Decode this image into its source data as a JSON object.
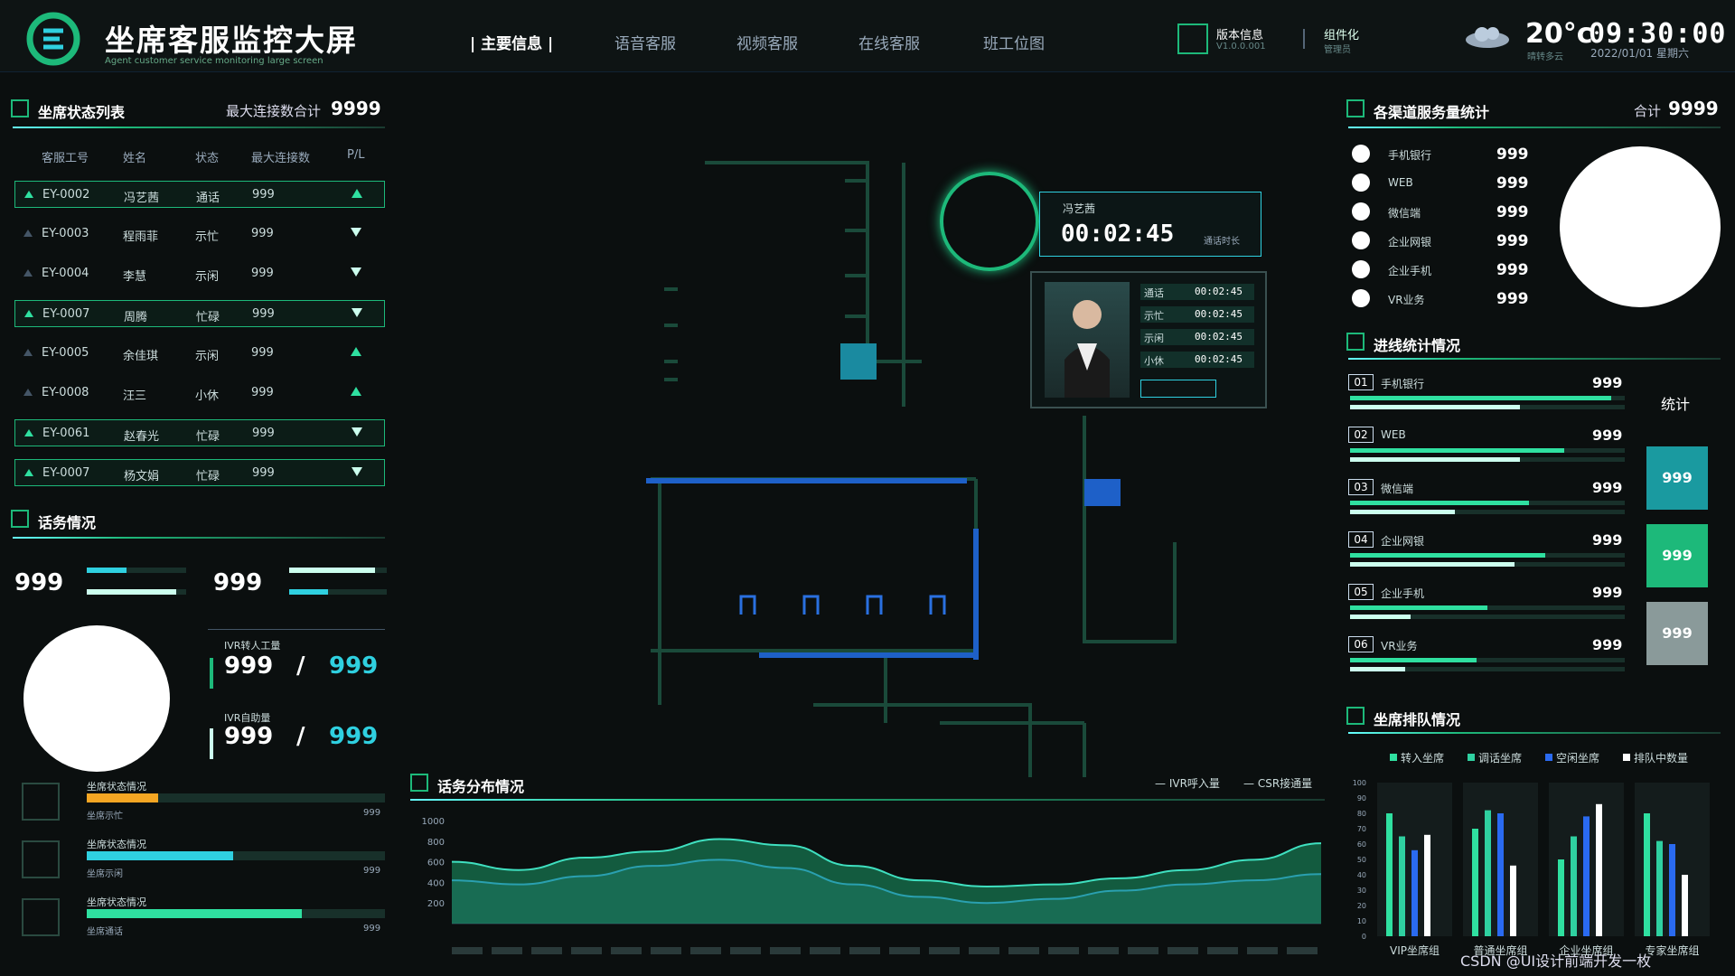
{
  "header": {
    "title": "坐席客服监控大屏",
    "subtitle": "Agent customer service monitoring large screen",
    "nav": [
      "| 主要信息 |",
      "语音客服",
      "视频客服",
      "在线客服",
      "班工位图"
    ],
    "version_label": "版本信息",
    "version_sub": "V1.0.0.001",
    "org_label": "组件化",
    "org_sub": "管理员",
    "temperature": "20°c",
    "time": "09:30:00",
    "date": "2022/01/01 星期六",
    "weather": "晴转多云"
  },
  "agent_status": {
    "title": "坐席状态列表",
    "max_conn_label": "最大连接数合计",
    "max_conn_value": "9999",
    "columns": [
      "客服工号",
      "姓名",
      "状态",
      "最大连接数",
      "P/L"
    ],
    "rows": [
      {
        "id": "EY-0002",
        "name": "冯艺茜",
        "status": "通话",
        "max": "999",
        "dir": "up",
        "hl": true
      },
      {
        "id": "EY-0003",
        "name": "程雨菲",
        "status": "示忙",
        "max": "999",
        "dir": "down",
        "hl": false
      },
      {
        "id": "EY-0004",
        "name": "李慧",
        "status": "示闲",
        "max": "999",
        "dir": "down",
        "hl": false
      },
      {
        "id": "EY-0007",
        "name": "周腾",
        "status": "忙碌",
        "max": "999",
        "dir": "down",
        "hl": true
      },
      {
        "id": "EY-0005",
        "name": "余佳琪",
        "status": "示闲",
        "max": "999",
        "dir": "up",
        "hl": false
      },
      {
        "id": "EY-0008",
        "name": "汪三",
        "status": "小休",
        "max": "999",
        "dir": "up",
        "hl": false
      },
      {
        "id": "EY-0061",
        "name": "赵春光",
        "status": "忙碌",
        "max": "999",
        "dir": "down",
        "hl": true
      },
      {
        "id": "EY-0007",
        "name": "杨文娟",
        "status": "忙碌",
        "max": "999",
        "dir": "down",
        "hl": true
      }
    ]
  },
  "call_info": {
    "title": "话务情况",
    "left_value": "999",
    "right_value": "999",
    "ivr_transfer_label": "IVR转人工量",
    "ivr_transfer_a": "999",
    "ivr_transfer_b": "999",
    "ivr_self_label": "IVR自助量",
    "ivr_self_a": "999",
    "ivr_self_b": "999",
    "status_items": [
      {
        "title": "坐席状态情况",
        "sub": "坐席示忙",
        "value": "999",
        "fill": 0.24,
        "color": "#f5a623"
      },
      {
        "title": "坐席状态情况",
        "sub": "坐席示闲",
        "value": "999",
        "fill": 0.49,
        "color": "#2fd0e0"
      },
      {
        "title": "坐席状态情况",
        "sub": "坐席通话",
        "value": "999",
        "fill": 0.72,
        "color": "#2fe0a0"
      }
    ]
  },
  "call_card": {
    "name": "冯艺茜",
    "duration": "00:02:45",
    "duration_label": "通话时长",
    "rows": [
      {
        "label": "通话",
        "value": "00:02:45"
      },
      {
        "label": "示忙",
        "value": "00:02:45"
      },
      {
        "label": "示闲",
        "value": "00:02:45"
      },
      {
        "label": "小休",
        "value": "00:02:45"
      }
    ]
  },
  "channel_stats": {
    "title": "各渠道服务量统计",
    "total_label": "合计",
    "total_value": "9999",
    "items": [
      {
        "label": "手机银行",
        "value": "999"
      },
      {
        "label": "WEB",
        "value": "999"
      },
      {
        "label": "微信端",
        "value": "999"
      },
      {
        "label": "企业网银",
        "value": "999"
      },
      {
        "label": "企业手机",
        "value": "999"
      },
      {
        "label": "VR业务",
        "value": "999"
      }
    ]
  },
  "incoming": {
    "title": "进线统计情况",
    "stat_label": "统计",
    "items": [
      {
        "no": "01",
        "label": "手机银行",
        "value": "999",
        "a": 0.95,
        "b": 0.62
      },
      {
        "no": "02",
        "label": "WEB",
        "value": "999",
        "a": 0.78,
        "b": 0.62
      },
      {
        "no": "03",
        "label": "微信端",
        "value": "999",
        "a": 0.65,
        "b": 0.38
      },
      {
        "no": "04",
        "label": "企业网银",
        "value": "999",
        "a": 0.71,
        "b": 0.6
      },
      {
        "no": "05",
        "label": "企业手机",
        "value": "999",
        "a": 0.5,
        "b": 0.22
      },
      {
        "no": "06",
        "label": "VR业务",
        "value": "999",
        "a": 0.46,
        "b": 0.2
      }
    ],
    "boxes": [
      {
        "value": "999",
        "color": "#1a9aa0"
      },
      {
        "value": "999",
        "color": "#1db97a"
      },
      {
        "value": "999",
        "color": "#8a9a9a"
      }
    ]
  },
  "queue": {
    "title": "坐席排队情况",
    "legend": [
      {
        "label": "转入坐席",
        "color": "#2fe0a0"
      },
      {
        "label": "调话坐席",
        "color": "#2fd0a0"
      },
      {
        "label": "空闲坐席",
        "color": "#2a6af0"
      },
      {
        "label": "排队中数量",
        "color": "#ffffff"
      }
    ],
    "chart_data": {
      "type": "bar",
      "categories": [
        "VIP坐席组",
        "普通坐席组",
        "企业坐席组",
        "专家坐席组"
      ],
      "ylim": [
        0,
        100
      ],
      "y_ticks": [
        "0",
        "10",
        "20",
        "30",
        "40",
        "50",
        "60",
        "70",
        "80",
        "90",
        "100"
      ],
      "series": [
        {
          "name": "转入坐席",
          "values": [
            80,
            70,
            50,
            80
          ]
        },
        {
          "name": "调话坐席",
          "values": [
            65,
            82,
            65,
            62
          ]
        },
        {
          "name": "空闲坐席",
          "values": [
            56,
            80,
            78,
            60
          ]
        },
        {
          "name": "排队中数量",
          "values": [
            66,
            46,
            86,
            40
          ]
        }
      ]
    }
  },
  "distribution": {
    "title": "话务分布情况",
    "legend": [
      {
        "label": "IVR呼入量",
        "color": "#cfe"
      },
      {
        "label": "CSR接通量",
        "color": "#cfe"
      }
    ],
    "chart_data": {
      "type": "area",
      "y_ticks": [
        "1000",
        "800",
        "600",
        "400",
        "200"
      ],
      "series": [
        {
          "name": "IVR呼入量",
          "values": [
            600,
            520,
            640,
            700,
            820,
            760,
            560,
            420,
            360,
            380,
            440,
            520,
            620,
            780
          ]
        },
        {
          "name": "CSR接通量",
          "values": [
            420,
            380,
            460,
            560,
            620,
            540,
            380,
            260,
            200,
            240,
            320,
            380,
            420,
            480
          ]
        }
      ]
    }
  },
  "watermark": "CSDN @UI设计前端开发一枚"
}
